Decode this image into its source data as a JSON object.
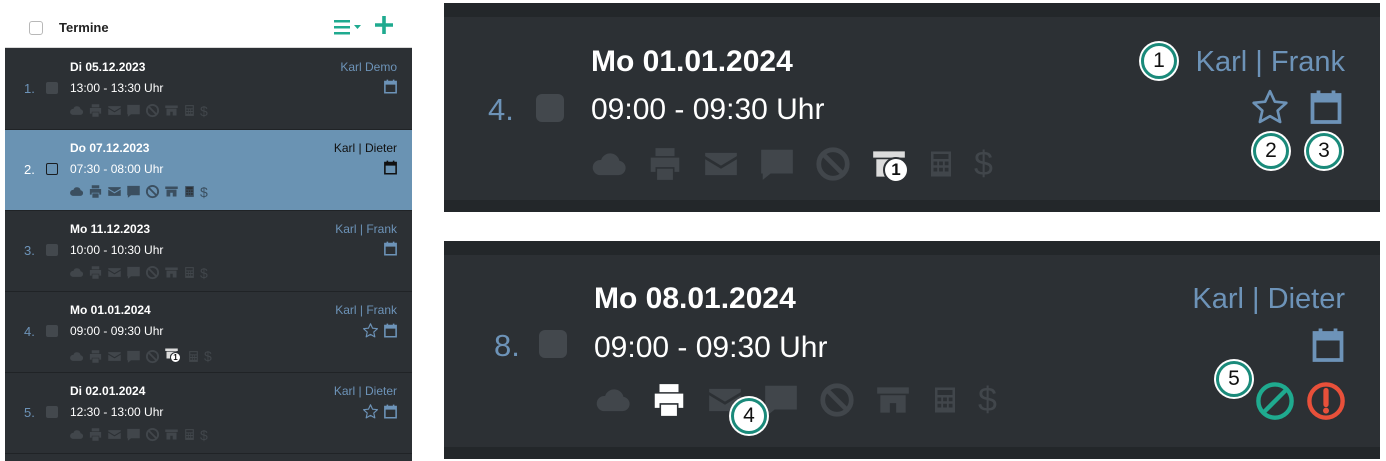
{
  "list": {
    "title": "Termine",
    "rows": [
      {
        "num": "1.",
        "date": "Di 05.12.2023",
        "time": "13:00 - 13:30 Uhr",
        "names": "Karl Demo"
      },
      {
        "num": "2.",
        "date": "Do 07.12.2023",
        "time": "07:30 - 08:00 Uhr",
        "names": "Karl | Dieter"
      },
      {
        "num": "3.",
        "date": "Mo 11.12.2023",
        "time": "10:00 - 10:30 Uhr",
        "names": "Karl | Frank"
      },
      {
        "num": "4.",
        "date": "Mo 01.01.2024",
        "time": "09:00 - 09:30 Uhr",
        "names": "Karl | Frank",
        "badge": "1"
      },
      {
        "num": "5.",
        "date": "Di 02.01.2024",
        "time": "12:30 - 13:00 Uhr",
        "names": "Karl | Dieter"
      }
    ]
  },
  "detail1": {
    "num": "4.",
    "date": "Mo 01.01.2024",
    "time": "09:00 - 09:30 Uhr",
    "names": "Karl | Frank",
    "badge": "1"
  },
  "detail2": {
    "num": "8.",
    "date": "Mo 08.01.2024",
    "time": "09:00 - 09:30 Uhr",
    "names": "Karl | Dieter"
  },
  "callouts": [
    "1",
    "2",
    "3",
    "4",
    "5"
  ],
  "icons": [
    "cloud-icon",
    "printer-icon",
    "envelope-icon",
    "chat-icon",
    "blocked-icon",
    "store-icon",
    "calculator-icon",
    "dollar-icon",
    "calendar-icon",
    "star-icon",
    "list-menu-icon",
    "plus-icon",
    "cancel-circle-icon",
    "alert-circle-icon"
  ],
  "colors": {
    "panel_bg": "#2c3034",
    "selected_bg": "#6a93b3",
    "accent_blue": "#6d93b8",
    "accent_teal": "#1faa8f",
    "alert_red": "#e8503a",
    "icon_dim": "#41464b"
  }
}
